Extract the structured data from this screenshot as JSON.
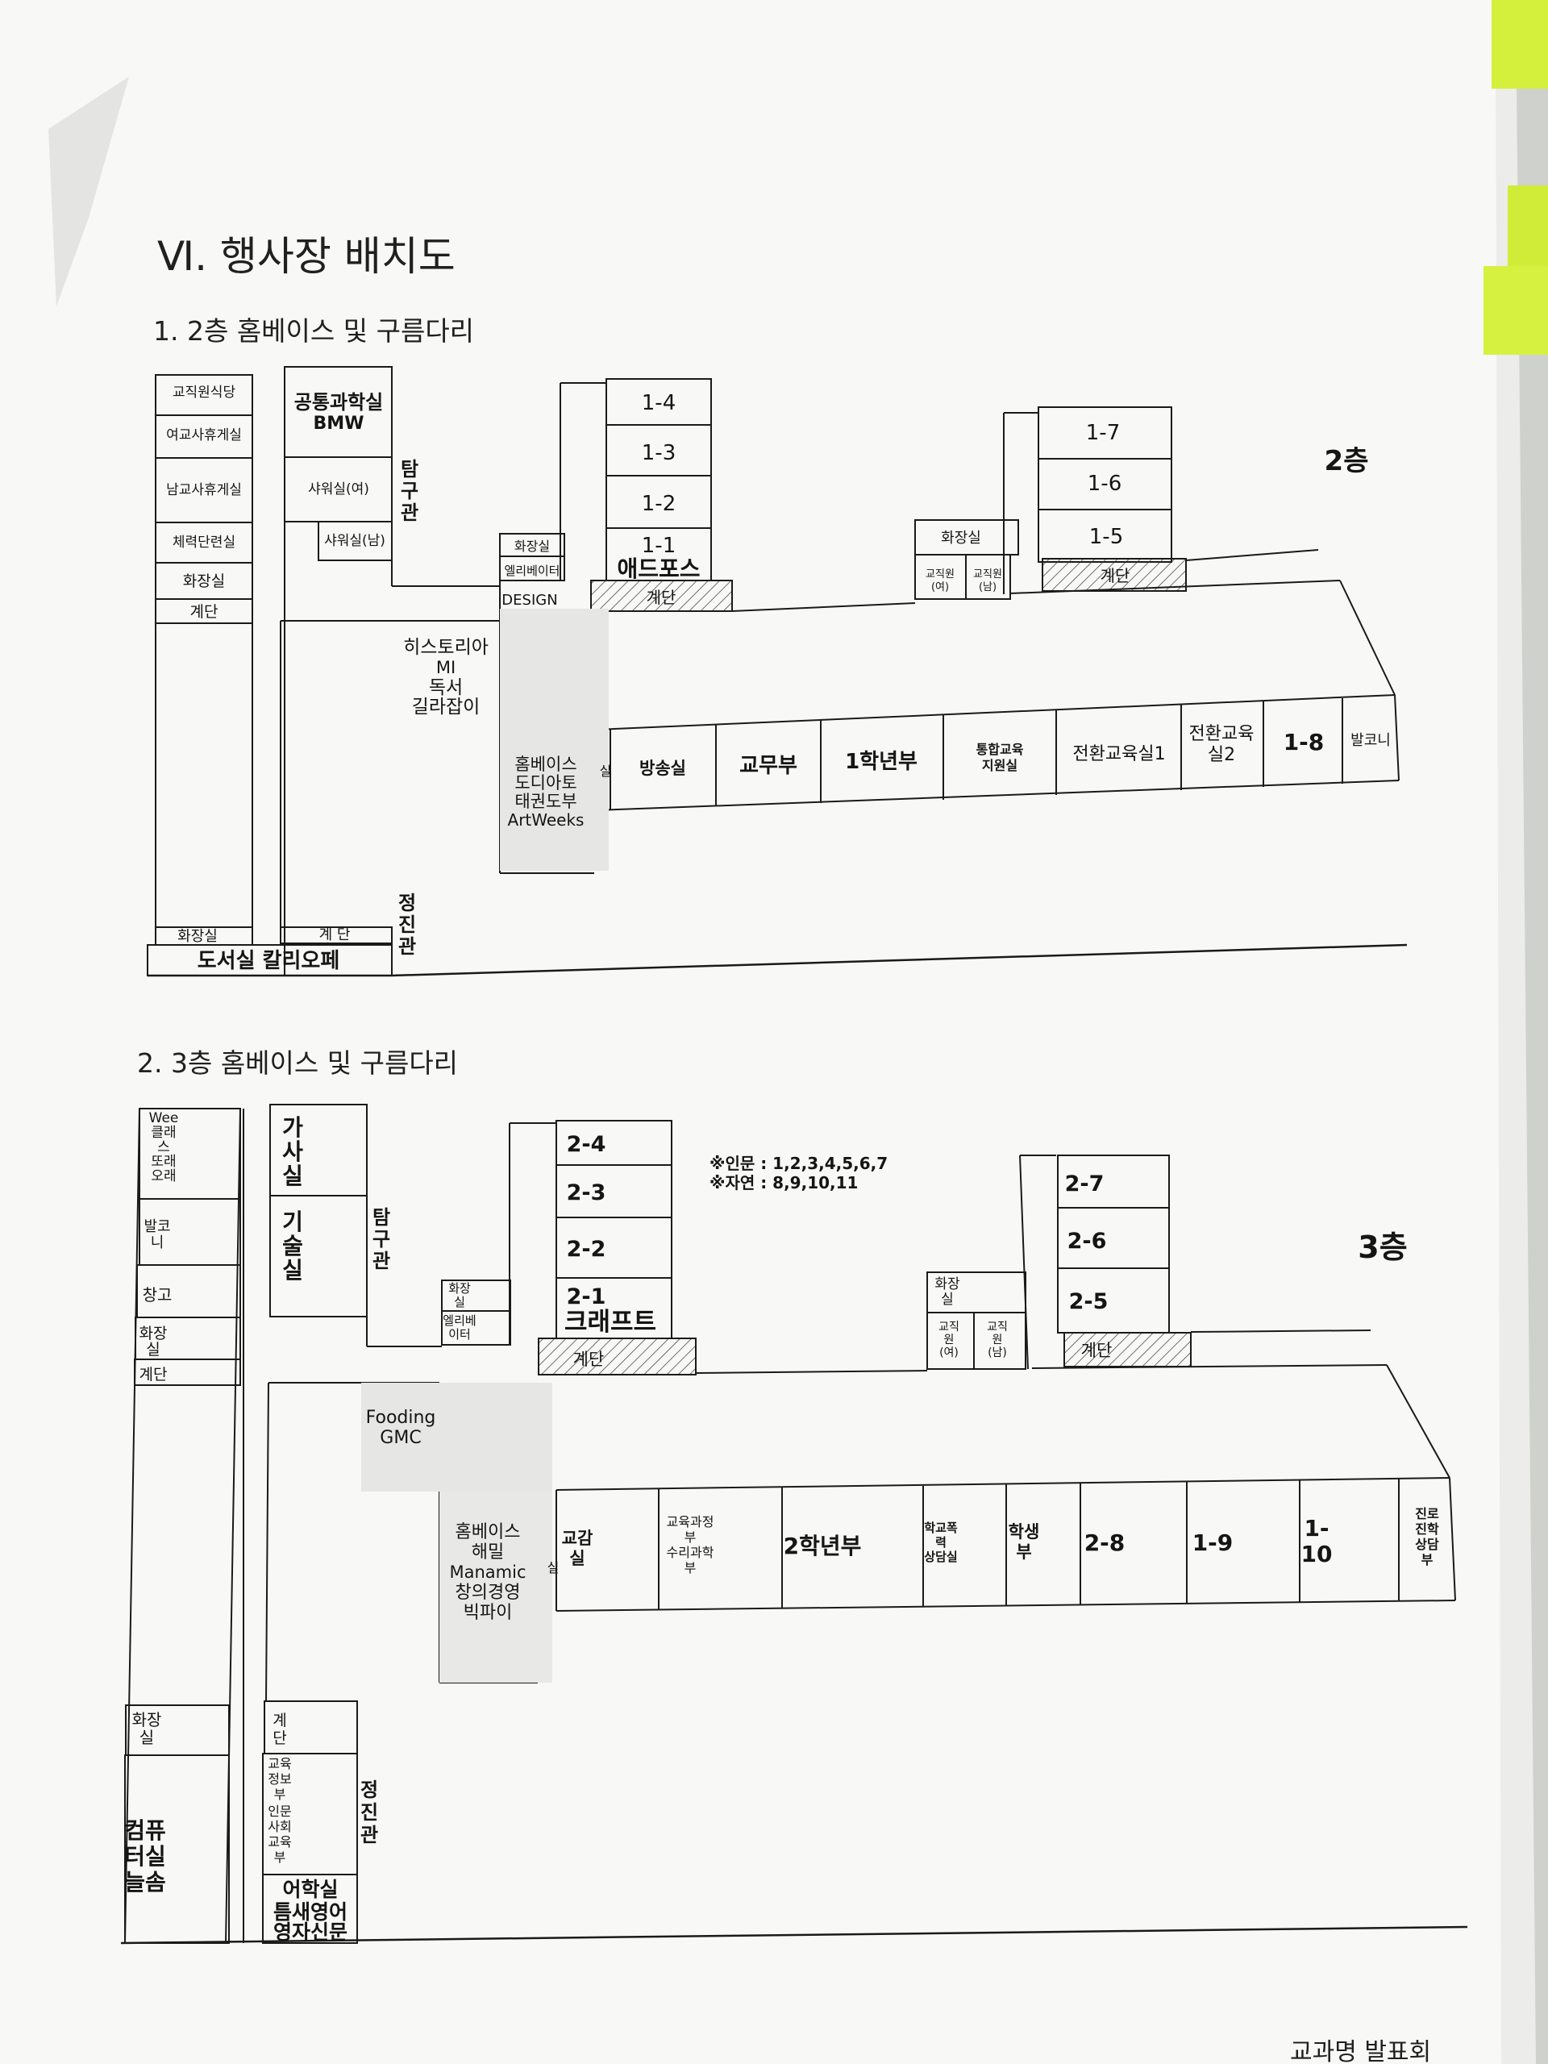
{
  "document": {
    "title": "Ⅵ. 행사장 배치도",
    "section1_title": "1. 2층 홈베이스 및 구름다리",
    "section2_title": "2. 3층 홈베이스 및 구름다리",
    "floor2_label": "2층",
    "floor3_label": "3층",
    "footer_text": "교과명 발표회"
  },
  "floor2": {
    "staff_cafeteria": "교직원식당",
    "female_lounge": "여교사휴게실",
    "male_lounge": "남교사휴게실",
    "fitness_room": "체력단련실",
    "restroom_top": "화장실",
    "stairs_left": "계단",
    "common_science_1": "공통과학실",
    "common_science_2": "BMW",
    "shower_f": "샤워실(여)",
    "shower_m": "샤워실(남)",
    "tamgu_1": "탐",
    "tamgu_2": "구",
    "tamgu_3": "관",
    "restroom_mid": "화장실",
    "elevator": "엘리베이터",
    "design": "DESIGN",
    "room_1_4": "1-4",
    "room_1_3": "1-3",
    "room_1_2": "1-2",
    "room_1_1": "1-1",
    "adforce": "애드포스",
    "stairs_mid": "계단",
    "restroom_right": "화장실",
    "staff_f_1": "교직원",
    "staff_f_2": "(여)",
    "staff_m_1": "교직원",
    "staff_m_2": "(남)",
    "room_1_7": "1-7",
    "room_1_6": "1-6",
    "room_1_5": "1-5",
    "stairs_right": "계단",
    "history_1": "히스토리아",
    "history_2": "MI",
    "history_3": "독서",
    "history_4": "길라잡이",
    "homebase_1": "홈베이스",
    "homebase_2": "도디아토",
    "homebase_3": "태권도부",
    "homebase_4": "ArtWeeks",
    "cut_char": "실",
    "broadcast": "방송실",
    "academic": "교무부",
    "grade1": "1학년부",
    "integrated_1": "통합교육",
    "integrated_2": "지원실",
    "transition1": "전환교육실1",
    "transition2_1": "전환교육",
    "transition2_2": "실2",
    "room_1_8": "1-8",
    "balcony": "발코니",
    "restroom_bottom": "화장실",
    "stairs_bottom": "계 단",
    "jeongjin_1": "정",
    "jeongjin_2": "진",
    "jeongjin_3": "관",
    "library": "도서실 칼리오페"
  },
  "floor3": {
    "wee_1": "Wee",
    "wee_2": "클래",
    "wee_3": "스",
    "wee_4": "또래",
    "wee_5": "오래",
    "balcony_1": "발코",
    "balcony_2": "니",
    "storage": "창고",
    "restroom_top_1": "화장",
    "restroom_top_2": "실",
    "stairs_left": "계단",
    "home_ec_1": "가",
    "home_ec_2": "사",
    "home_ec_3": "실",
    "tech_1": "기",
    "tech_2": "술",
    "tech_3": "실",
    "tamgu_1": "탐",
    "tamgu_2": "구",
    "tamgu_3": "관",
    "restroom_mid_1": "화장",
    "restroom_mid_2": "실",
    "elevator_1": "엘리베",
    "elevator_2": "이터",
    "room_2_4": "2-4",
    "room_2_3": "2-3",
    "room_2_2": "2-2",
    "room_2_1": "2-1",
    "craft": "크래프트",
    "stairs_mid": "계단",
    "note_1": "※인문 : 1,2,3,4,5,6,7",
    "note_2": "※자연 : 8,9,10,11",
    "restroom_right_1": "화장",
    "restroom_right_2": "실",
    "staff_f_1": "교직",
    "staff_f_2": "원",
    "staff_f_3": "(여)",
    "staff_m_1": "교직",
    "staff_m_2": "원",
    "staff_m_3": "(남)",
    "room_2_7": "2-7",
    "room_2_6": "2-6",
    "room_2_5": "2-5",
    "stairs_right": "계단",
    "fooding_1": "Fooding",
    "fooding_2": "GMC",
    "homebase_1": "홈베이스",
    "homebase_2": "해밀",
    "homebase_3": "Manamic",
    "homebase_4": "창의경영",
    "homebase_5": "빅파이",
    "cut_char": "실",
    "admin_1": "교감",
    "admin_2": "실",
    "curriculum_1": "교육과정",
    "curriculum_2": "부",
    "curriculum_3": "수리과학",
    "curriculum_4": "부",
    "grade2": "2학년부",
    "counsel_1": "학교폭",
    "counsel_2": "력",
    "counsel_3": "상담실",
    "student_1": "학생",
    "student_2": "부",
    "room_2_8": "2-8",
    "room_1_9": "1-9",
    "room_1_10_a": "1-",
    "room_1_10_b": "10",
    "career_1": "진로",
    "career_2": "진학",
    "career_3": "상담",
    "career_4": "부",
    "restroom_bottom_1": "화장",
    "restroom_bottom_2": "실",
    "computer_1": "컴퓨",
    "computer_2": "터실",
    "computer_3": "늘솜",
    "stairs_bottom_1": "계",
    "stairs_bottom_2": "단",
    "edu_info_1": "교육",
    "edu_info_2": "정보",
    "edu_info_3": "부",
    "edu_info_4": "인문",
    "edu_info_5": "사회",
    "edu_info_6": "교육",
    "edu_info_7": "부",
    "language_1": "어학실",
    "language_2": "틈새영어",
    "language_3": "영자신문",
    "jeongjin_1": "정",
    "jeongjin_2": "진",
    "jeongjin_3": "관"
  },
  "colors": {
    "paper": "#f7f7f5",
    "ink": "#151515",
    "sticky_note": "#d4f03c"
  }
}
